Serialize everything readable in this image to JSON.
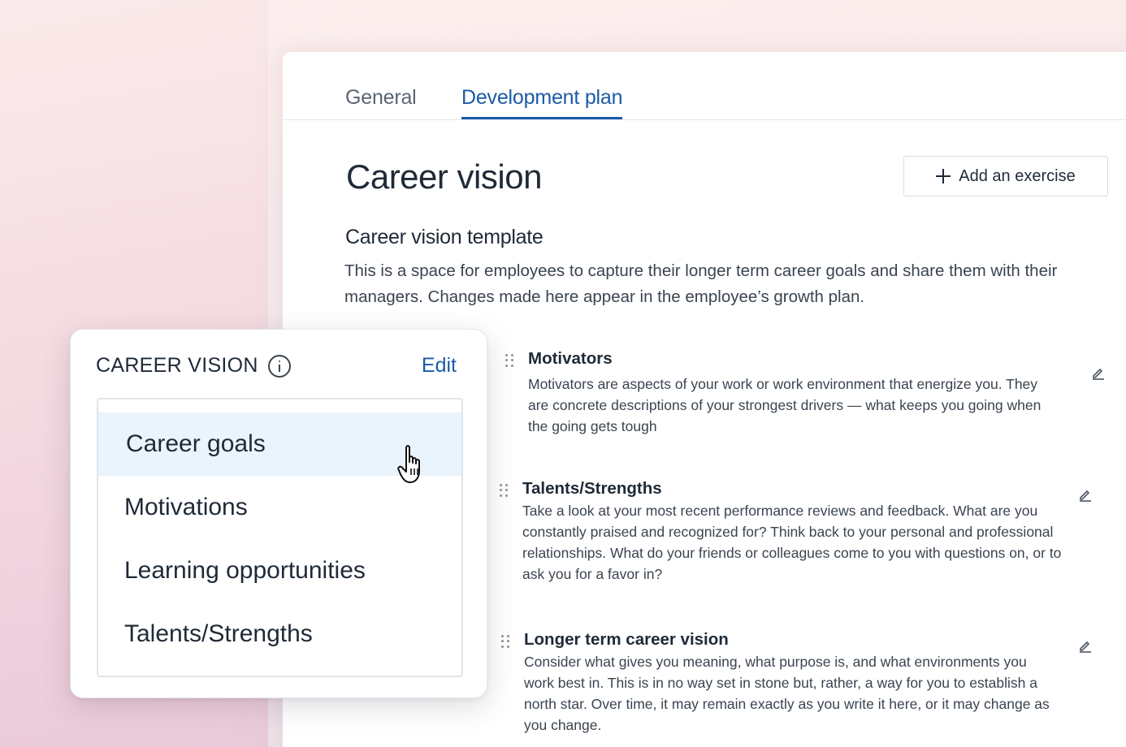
{
  "tabs": [
    {
      "label": "General",
      "active": false
    },
    {
      "label": "Development plan",
      "active": true
    }
  ],
  "page": {
    "title": "Career vision",
    "add_button_label": "Add an exercise",
    "section_title": "Career vision template",
    "section_description": "This is a space for employees to capture their longer term career goals and share them with their managers. Changes made here appear in the employee’s growth plan."
  },
  "exercises": [
    {
      "title": "Motivators",
      "body": "Motivators are aspects of your work or work environment that energize you. They are concrete descriptions of your strongest drivers — what keeps you going when the going gets tough"
    },
    {
      "title": "Talents/Strengths",
      "body": "Take a look at your most recent performance reviews and feedback. What are you constantly praised and recognized for? Think back to your personal and professional relationships. What do your friends or colleagues come to you with questions on, or to ask you for a favor in?"
    },
    {
      "title": "Longer term career vision",
      "body": "Consider what gives you meaning, what purpose is, and what environments you work best in. This is in no way set in stone but, rather, a way for you to establish a north star. Over time, it may remain exactly as you write it here, or it may change as you change."
    }
  ],
  "popup": {
    "title": "CAREER VISION",
    "edit_label": "Edit",
    "items": [
      {
        "label": "Career goals",
        "active": true
      },
      {
        "label": "Motivations",
        "active": false
      },
      {
        "label": "Learning opportunities",
        "active": false
      },
      {
        "label": "Talents/Strengths",
        "active": false
      }
    ]
  },
  "icons": {
    "add": "plus-icon",
    "info": "info-icon",
    "edit": "pencil-icon",
    "drag": "drag-handle-icon",
    "cursor": "hand-pointer-icon"
  },
  "colors": {
    "accent": "#1c5aa8",
    "active_item_bg": "#e9f4fd",
    "text_primary": "#1f2a37"
  }
}
